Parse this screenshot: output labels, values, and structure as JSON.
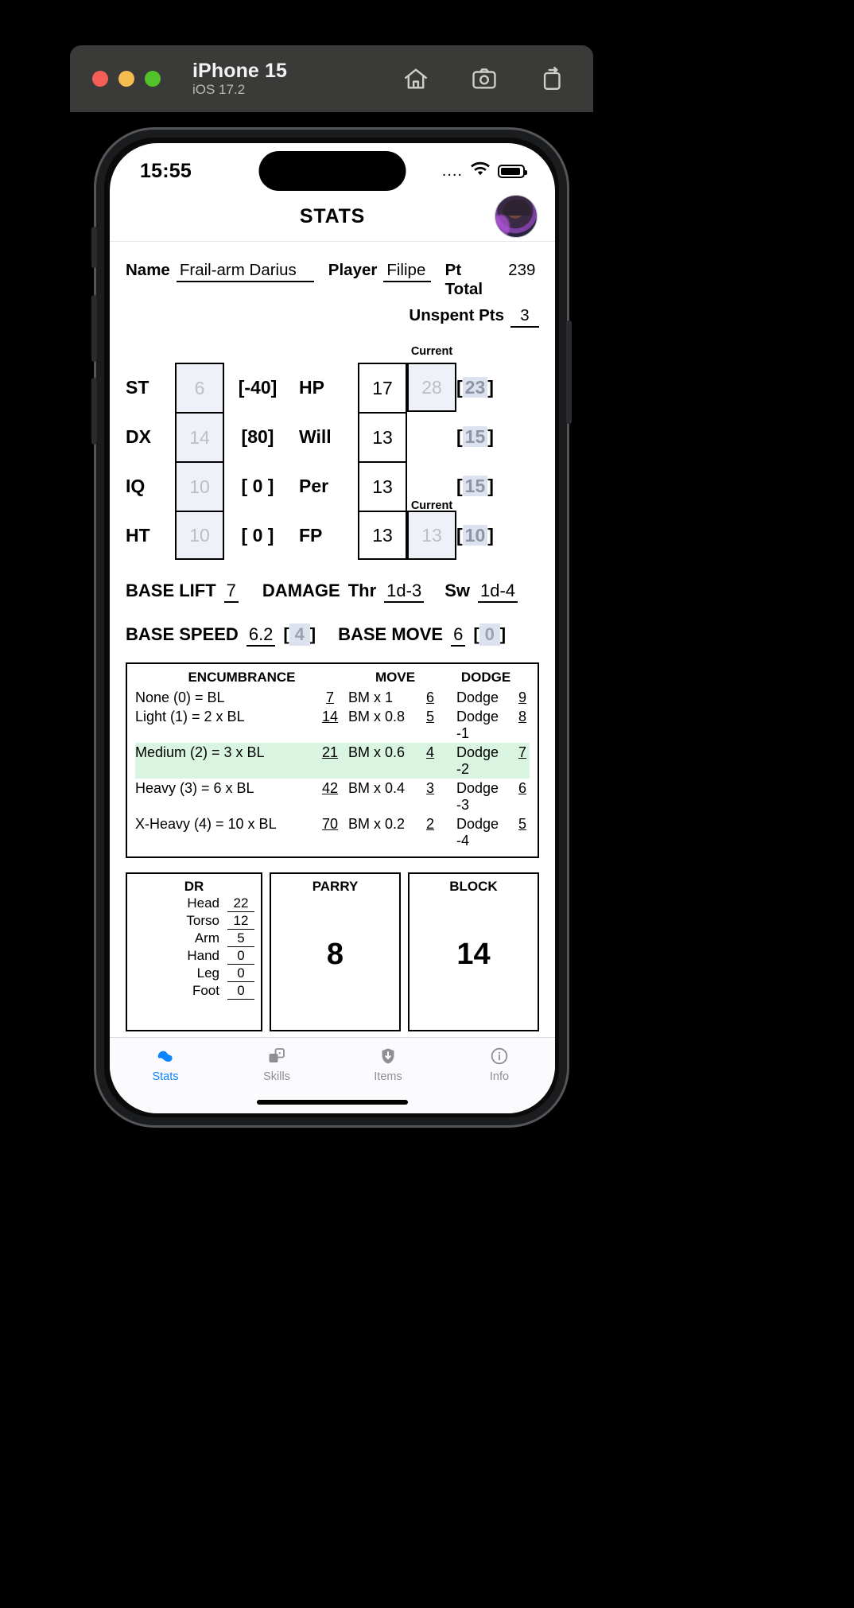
{
  "simulator": {
    "device_name": "iPhone 15",
    "os_version": "iOS 17.2",
    "tools": [
      {
        "name": "home-icon",
        "label": "Home"
      },
      {
        "name": "screenshot-icon",
        "label": "Screenshot"
      },
      {
        "name": "rotate-icon",
        "label": "Rotate"
      }
    ]
  },
  "status_bar": {
    "time": "15:55",
    "signal": "....",
    "wifi_icon": "wifi-icon",
    "battery_icon": "battery-icon"
  },
  "nav": {
    "title": "STATS",
    "avatar": "character-avatar"
  },
  "identity": {
    "name_label": "Name",
    "name_value": "Frail-arm Darius",
    "player_label": "Player",
    "player_value": "Filipe",
    "pt_total_label": "Pt Total",
    "pt_total_value": "239",
    "unspent_label": "Unspent Pts",
    "unspent_value": "3"
  },
  "attributes": {
    "current_caption": "Current",
    "primary": [
      {
        "name": "ST",
        "value": "6",
        "cost": "[-40]",
        "placeholder": true
      },
      {
        "name": "DX",
        "value": "14",
        "cost": "[80]",
        "placeholder": true
      },
      {
        "name": "IQ",
        "value": "10",
        "cost": "[ 0 ]",
        "placeholder": true
      },
      {
        "name": "HT",
        "value": "10",
        "cost": "[ 0 ]",
        "placeholder": true
      }
    ],
    "secondary": [
      {
        "name": "HP",
        "value": "17",
        "current": "28",
        "cost": "23",
        "has_current_box": true,
        "current_caption": "Current"
      },
      {
        "name": "Will",
        "value": "13",
        "current": "",
        "cost": "15",
        "has_current_box": false,
        "current_caption": ""
      },
      {
        "name": "Per",
        "value": "13",
        "current": "",
        "cost": "15",
        "has_current_box": false,
        "current_caption": "Current"
      },
      {
        "name": "FP",
        "value": "13",
        "current": "13",
        "cost": "10",
        "has_current_box": true,
        "current_caption": ""
      }
    ]
  },
  "base": {
    "lift_label": "BASE LIFT",
    "lift_value": "7",
    "damage_label": "DAMAGE",
    "thr_label": "Thr",
    "thr_value": "1d-3",
    "sw_label": "Sw",
    "sw_value": "1d-4",
    "speed_label": "BASE SPEED",
    "speed_value": "6.2",
    "speed_cost": "4",
    "move_label": "BASE MOVE",
    "move_value": "6",
    "move_cost": "0"
  },
  "encumbrance": {
    "headers": [
      "ENCUMBRANCE",
      "MOVE",
      "DODGE"
    ],
    "rows": [
      {
        "enc": "None (0) = BL",
        "bl": "7",
        "move": "BM x 1",
        "move_val": "6",
        "dodge": "Dodge",
        "dodge_val": "9",
        "highlight": false
      },
      {
        "enc": "Light (1) = 2 x BL",
        "bl": "14",
        "move": "BM x 0.8",
        "move_val": "5",
        "dodge": "Dodge -1",
        "dodge_val": "8",
        "highlight": false
      },
      {
        "enc": "Medium (2) = 3 x BL",
        "bl": "21",
        "move": "BM x 0.6",
        "move_val": "4",
        "dodge": "Dodge -2",
        "dodge_val": "7",
        "highlight": true
      },
      {
        "enc": "Heavy (3) = 6 x BL",
        "bl": "42",
        "move": "BM x 0.4",
        "move_val": "3",
        "dodge": "Dodge -3",
        "dodge_val": "6",
        "highlight": false
      },
      {
        "enc": "X-Heavy (4) = 10 x BL",
        "bl": "70",
        "move": "BM x 0.2",
        "move_val": "2",
        "dodge": "Dodge -4",
        "dodge_val": "5",
        "highlight": false
      }
    ]
  },
  "defense": {
    "dr_title": "DR",
    "dr_rows": [
      {
        "part": "Head",
        "value": "22"
      },
      {
        "part": "Torso",
        "value": "12"
      },
      {
        "part": "Arm",
        "value": "5"
      },
      {
        "part": "Hand",
        "value": "0"
      },
      {
        "part": "Leg",
        "value": "0"
      },
      {
        "part": "Foot",
        "value": "0"
      }
    ],
    "parry_title": "PARRY",
    "parry_value": "8",
    "block_title": "BLOCK",
    "block_value": "14"
  },
  "tabs": [
    {
      "label": "Stats",
      "icon": "muscle-icon",
      "active": true
    },
    {
      "label": "Skills",
      "icon": "dice-icon",
      "active": false
    },
    {
      "label": "Items",
      "icon": "shield-icon",
      "active": false
    },
    {
      "label": "Info",
      "icon": "info-icon",
      "active": false
    }
  ],
  "colors": {
    "accent": "#0a84ff",
    "placeholder_bg": "#eef2f8",
    "placeholder_fg": "#b9bfc9",
    "highlight_row": "#d9f5e2",
    "bracket_hl": "#dde3ee"
  }
}
